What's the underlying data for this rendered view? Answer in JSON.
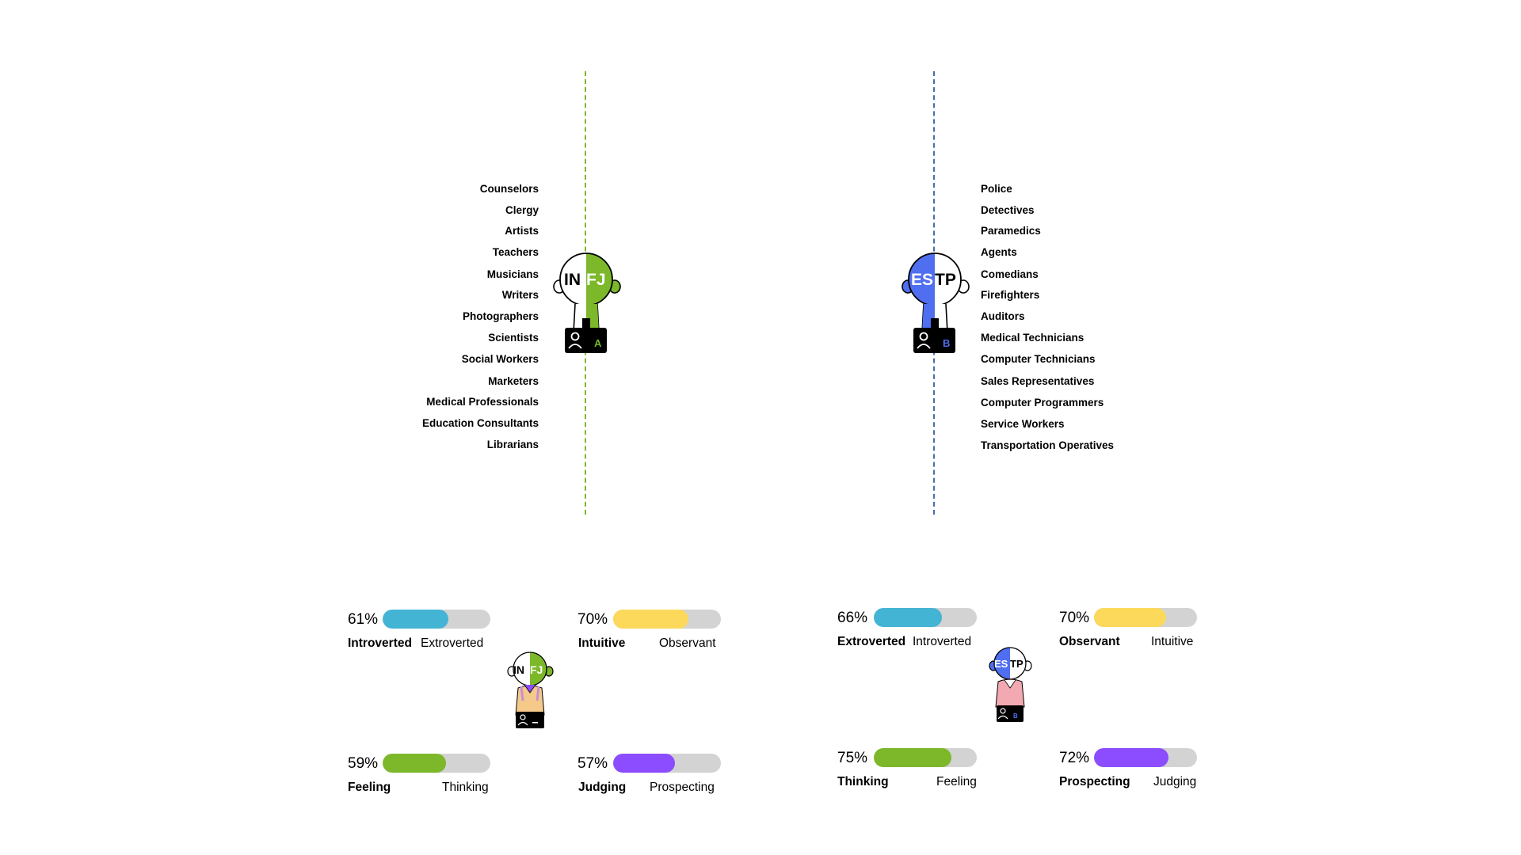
{
  "colors": {
    "infj_line": "#7cb82a",
    "estp_line": "#4a6cad",
    "infj_accent": "#7cb82a",
    "estp_accent": "#4f6ef0",
    "bar_track": "#d3d3d3",
    "energy": "#44b4d4",
    "mind": "#fcd95a",
    "nature": "#7cb82a",
    "tactics": "#8b4dff"
  },
  "infj": {
    "code_left": "IN",
    "code_right": "FJ",
    "badge_letter": "A",
    "careers": [
      "Counselors",
      "Clergy",
      "Artists",
      "Teachers",
      "Musicians",
      "Writers",
      "Photographers",
      "Scientists",
      "Social Workers",
      "Marketers",
      "Medical Professionals",
      "Education Consultants",
      "Librarians"
    ],
    "traits": {
      "energy": {
        "percent": 0.61,
        "percent_label": "61%",
        "strong": "Introverted",
        "other": "Extroverted"
      },
      "mind": {
        "percent": 0.7,
        "percent_label": "70%",
        "strong": "Intuitive",
        "other": "Observant"
      },
      "nature": {
        "percent": 0.59,
        "percent_label": "59%",
        "strong": "Feeling",
        "other": "Thinking"
      },
      "tactics": {
        "percent": 0.57,
        "percent_label": "57%",
        "strong": "Judging",
        "other": "Prospecting"
      }
    }
  },
  "estp": {
    "code_left": "ES",
    "code_right": "TP",
    "badge_letter": "B",
    "careers": [
      "Police",
      "Detectives",
      "Paramedics",
      "Agents",
      "Comedians",
      "Firefighters",
      "Auditors",
      "Medical Technicians",
      "Computer Technicians",
      "Sales Representatives",
      "Computer Programmers",
      "Service Workers",
      "Transportation Operatives"
    ],
    "traits": {
      "energy": {
        "percent": 0.66,
        "percent_label": "66%",
        "strong": "Extroverted",
        "other": "Introverted"
      },
      "mind": {
        "percent": 0.7,
        "percent_label": "70%",
        "strong": "Observant",
        "other": "Intuitive"
      },
      "nature": {
        "percent": 0.75,
        "percent_label": "75%",
        "strong": "Thinking",
        "other": "Feeling"
      },
      "tactics": {
        "percent": 0.72,
        "percent_label": "72%",
        "strong": "Prospecting",
        "other": "Judging"
      }
    }
  }
}
